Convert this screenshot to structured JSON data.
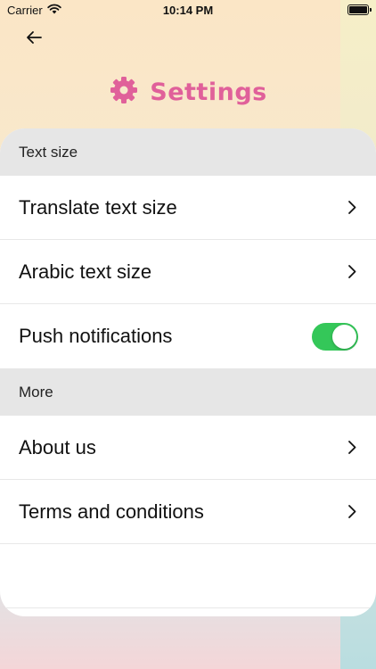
{
  "status_bar": {
    "carrier": "Carrier",
    "time": "10:14 PM",
    "battery_level": 1.0
  },
  "header": {
    "back_icon": "arrow-left-icon",
    "title": "Settings",
    "title_icon": "gear-icon",
    "accent_color": "#e0609a"
  },
  "sections": [
    {
      "header": "Text size",
      "rows": [
        {
          "label": "Translate text size",
          "control": "chevron"
        },
        {
          "label": "Arabic text size",
          "control": "chevron"
        },
        {
          "label": "Push notifications",
          "control": "toggle",
          "toggle_on": true
        }
      ]
    },
    {
      "header": "More",
      "rows": [
        {
          "label": "About us",
          "control": "chevron"
        },
        {
          "label": "Terms and conditions",
          "control": "chevron"
        }
      ]
    }
  ],
  "colors": {
    "toggle_on": "#34c759",
    "section_header_bg": "#e6e6e6"
  }
}
